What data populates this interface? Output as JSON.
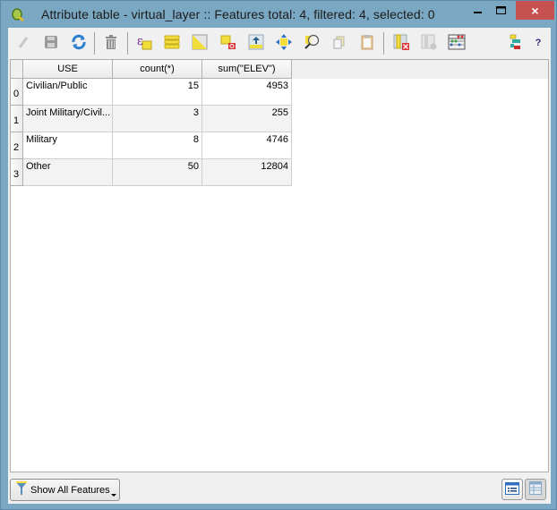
{
  "window": {
    "title": "Attribute table - virtual_layer :: Features total: 4, filtered: 4, selected: 0",
    "controls": {
      "minimize": "–",
      "maximize": "☐",
      "close": "×"
    }
  },
  "toolbar": {
    "items": [
      {
        "name": "toggle-editing",
        "icon": "pencil-icon",
        "enabled": false
      },
      {
        "name": "save-edits",
        "icon": "save-icon",
        "enabled": false
      },
      {
        "name": "reload",
        "icon": "refresh-icon",
        "enabled": true
      },
      {
        "name": "delete-selected",
        "icon": "trash-icon",
        "enabled": false
      },
      {
        "name": "select-by-expression",
        "icon": "expression-select-icon",
        "enabled": true
      },
      {
        "name": "select-all",
        "icon": "select-all-icon",
        "enabled": true
      },
      {
        "name": "invert-selection",
        "icon": "invert-selection-icon",
        "enabled": true
      },
      {
        "name": "deselect-all",
        "icon": "deselect-icon",
        "enabled": true
      },
      {
        "name": "move-selection-to-top",
        "icon": "move-to-top-icon",
        "enabled": true
      },
      {
        "name": "pan-to-selected",
        "icon": "pan-icon",
        "enabled": true
      },
      {
        "name": "zoom-to-selected",
        "icon": "zoom-map-icon",
        "enabled": true
      },
      {
        "name": "copy-selected",
        "icon": "copy-icon",
        "enabled": false
      },
      {
        "name": "paste-features",
        "icon": "paste-icon",
        "enabled": false
      },
      {
        "name": "delete-column",
        "icon": "delete-column-icon",
        "enabled": false
      },
      {
        "name": "new-column",
        "icon": "new-column-icon",
        "enabled": false
      },
      {
        "name": "field-calculator",
        "icon": "abacus-icon",
        "enabled": true
      },
      {
        "name": "conditional-formatting",
        "icon": "conditional-format-icon",
        "enabled": true
      },
      {
        "name": "help",
        "icon": "help-icon",
        "label": "?",
        "enabled": true
      }
    ]
  },
  "table": {
    "columns": [
      "USE",
      "count(*)",
      "sum(\"ELEV\")"
    ],
    "rows": [
      {
        "index": "0",
        "cells": [
          "Civilian/Public",
          "15",
          "4953"
        ]
      },
      {
        "index": "1",
        "cells": [
          "Joint Military/Civil...",
          "3",
          "255"
        ]
      },
      {
        "index": "2",
        "cells": [
          "Military",
          "8",
          "4746"
        ]
      },
      {
        "index": "3",
        "cells": [
          "Other",
          "50",
          "12804"
        ]
      }
    ]
  },
  "footer": {
    "filter_label": "Show All Features",
    "form_view": "form-view",
    "table_view": "table-view"
  }
}
